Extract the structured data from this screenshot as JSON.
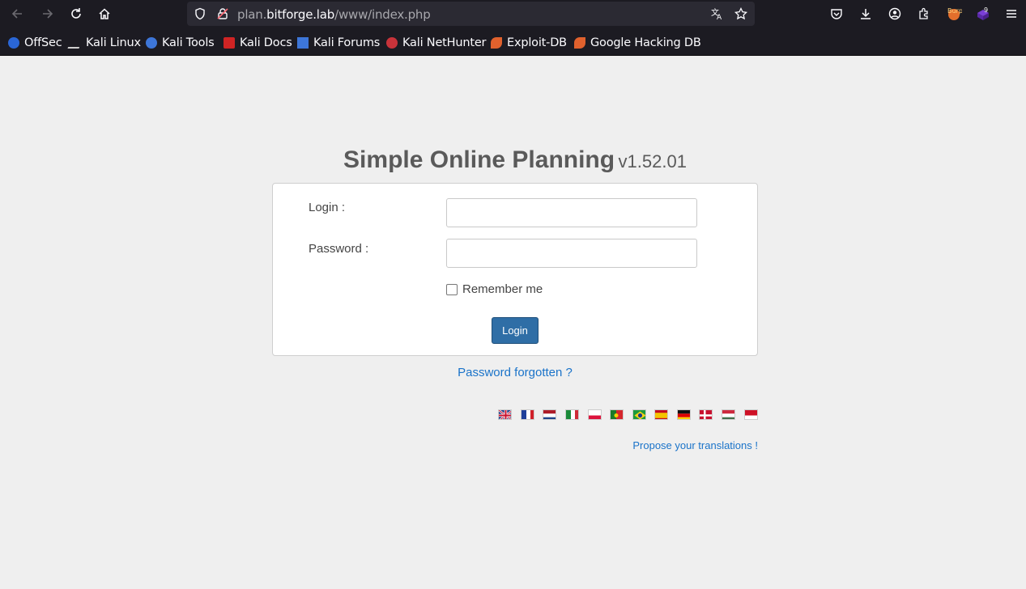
{
  "browser": {
    "url_prefix": "plan.",
    "url_host": "bitforge.lab",
    "url_path": "/www/index.php",
    "bookmarks": [
      {
        "label": "OffSec"
      },
      {
        "label": "Kali Linux"
      },
      {
        "label": "Kali Tools"
      },
      {
        "label": "Kali Docs"
      },
      {
        "label": "Kali Forums"
      },
      {
        "label": "Kali NetHunter"
      },
      {
        "label": "Exploit-DB"
      },
      {
        "label": "Google Hacking DB"
      }
    ],
    "extension_badge": "9",
    "burp_label": "Burp"
  },
  "page": {
    "app_name": "Simple Online Planning",
    "version": "v1.52.01",
    "login_label": "Login :",
    "password_label": "Password :",
    "remember_label": "Remember me",
    "login_button": "Login",
    "forgot_link": "Password forgotten ?",
    "propose_link": "Propose your translations !",
    "languages": [
      "en",
      "fr",
      "nl",
      "it",
      "pl",
      "pt",
      "br",
      "es",
      "de",
      "dk",
      "hu",
      "id"
    ]
  }
}
